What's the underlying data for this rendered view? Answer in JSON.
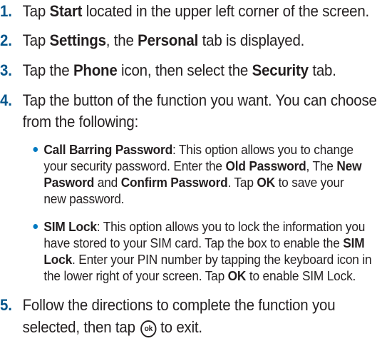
{
  "steps": [
    {
      "number": "1.",
      "parts": [
        {
          "t": "Tap ",
          "b": false
        },
        {
          "t": "Start",
          "b": true
        },
        {
          "t": " located in the upper left corner of the screen.",
          "b": false
        }
      ]
    },
    {
      "number": "2.",
      "parts": [
        {
          "t": "Tap ",
          "b": false
        },
        {
          "t": "Settings",
          "b": true
        },
        {
          "t": ", the ",
          "b": false
        },
        {
          "t": "Personal",
          "b": true
        },
        {
          "t": " tab is displayed.",
          "b": false
        }
      ]
    },
    {
      "number": "3.",
      "parts": [
        {
          "t": "Tap the ",
          "b": false
        },
        {
          "t": "Phone",
          "b": true
        },
        {
          "t": " icon, then select the ",
          "b": false
        },
        {
          "t": "Security",
          "b": true
        },
        {
          "t": " tab.",
          "b": false
        }
      ]
    },
    {
      "number": "4.",
      "lines": [
        "Tap the button of the function you want. You can choose",
        "from the following:"
      ]
    },
    {
      "number": "5.",
      "line1": "Follow the directions to complete the function you",
      "line2_before": "selected, then tap",
      "ok_icon": "ok",
      "line2_after": "to exit."
    }
  ],
  "bullets": [
    {
      "lines": [
        [
          {
            "t": "Call Barring Password",
            "b": true
          },
          {
            "t": ": This option allows you to change",
            "b": false
          }
        ],
        [
          {
            "t": "your security password. Enter the ",
            "b": false
          },
          {
            "t": "Old Password",
            "b": true
          },
          {
            "t": ", The ",
            "b": false
          },
          {
            "t": "New",
            "b": true
          }
        ],
        [
          {
            "t": "Pasword",
            "b": true
          },
          {
            "t": " and ",
            "b": false
          },
          {
            "t": "Confirm Password",
            "b": true
          },
          {
            "t": ". Tap ",
            "b": false
          },
          {
            "t": "OK",
            "b": true
          },
          {
            "t": " to save your",
            "b": false
          }
        ],
        [
          {
            "t": "new password.",
            "b": false
          }
        ]
      ]
    },
    {
      "lines": [
        [
          {
            "t": "SIM Lock",
            "b": true
          },
          {
            "t": ": This option allows you to lock the information you",
            "b": false
          }
        ],
        [
          {
            "t": "have stored to your SIM card. Tap the box to enable the ",
            "b": false
          },
          {
            "t": "SIM",
            "b": true
          }
        ],
        [
          {
            "t": "Lock",
            "b": true
          },
          {
            "t": ". Enter your PIN number by tapping the keyboard icon in",
            "b": false
          }
        ],
        [
          {
            "t": "the lower right of your screen. Tap ",
            "b": false
          },
          {
            "t": "OK",
            "b": true
          },
          {
            "t": " to enable SIM Lock.",
            "b": false
          }
        ]
      ]
    }
  ],
  "colors": {
    "step_number": "#00548b",
    "bullet": "#0079c1",
    "text": "#231f20"
  }
}
